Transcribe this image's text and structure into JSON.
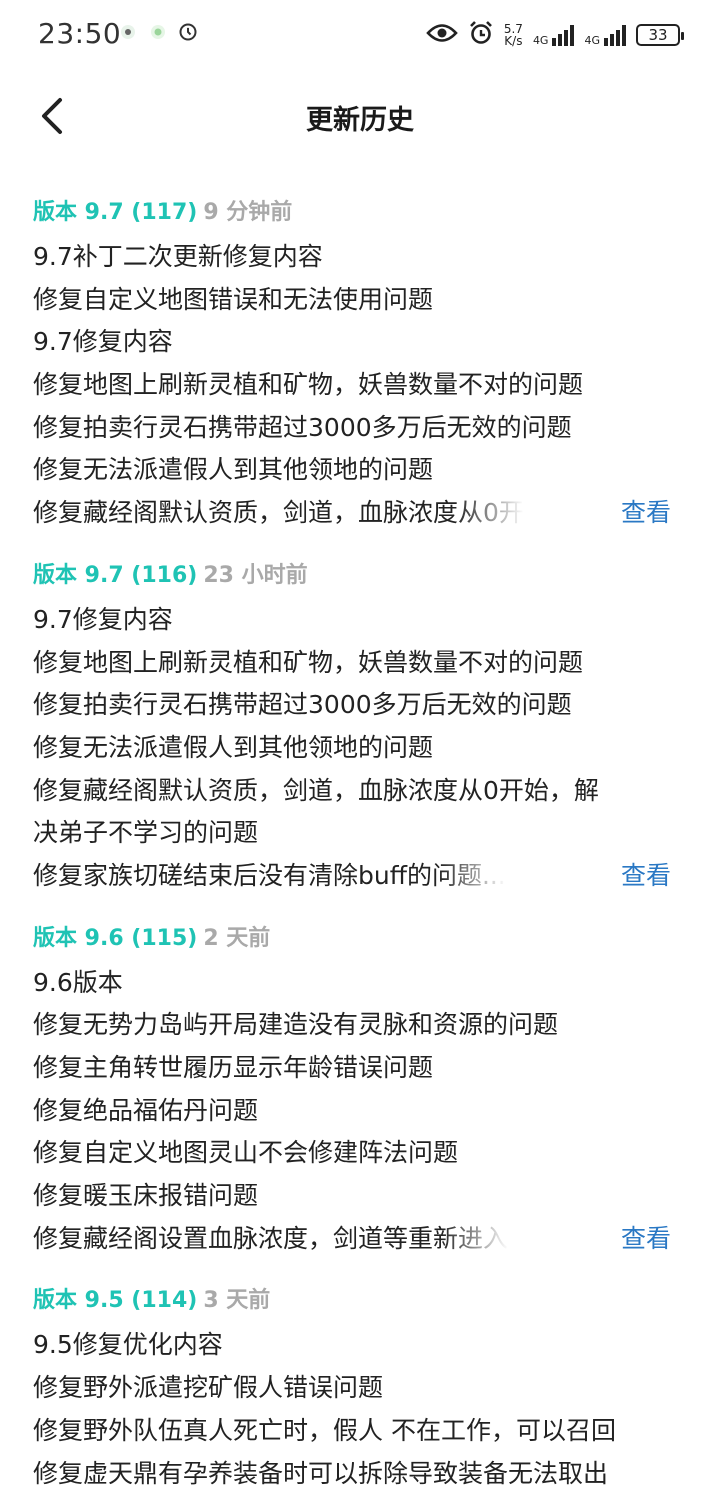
{
  "status_bar": {
    "time": "23:50",
    "speed_value": "5.7",
    "speed_unit": "K/s",
    "network1": "4G",
    "network2": "4G",
    "battery": "33",
    "icons": [
      "notification-dot-icon",
      "notification-dot-icon",
      "alarm-clock-icon",
      "eye-icon",
      "alarm-icon",
      "signal-icon",
      "battery-icon"
    ]
  },
  "header": {
    "title": "更新历史",
    "back_icon": "chevron-left-icon"
  },
  "view_label": "查看",
  "versions": [
    {
      "label": "版本 9.7 (117)",
      "time": "9 分钟前",
      "lines": [
        "9.7补丁二次更新修复内容",
        "修复自定义地图错误和无法使用问题",
        "9.7修复内容",
        "修复地图上刷新灵植和矿物，妖兽数量不对的问题",
        "修复拍卖行灵石携带超过3000多万后无效的问题",
        "修复无法派遣假人到其他领地的问题"
      ],
      "last_line": "修复藏经阁默认资质，剑道，血脉浓度从0开"
    },
    {
      "label": "版本 9.7 (116)",
      "time": "23 小时前",
      "lines": [
        "9.7修复内容",
        "修复地图上刷新灵植和矿物，妖兽数量不对的问题",
        "修复拍卖行灵石携带超过3000多万后无效的问题",
        "修复无法派遣假人到其他领地的问题",
        "修复藏经阁默认资质，剑道，血脉浓度从0开始，解",
        "决弟子不学习的问题"
      ],
      "last_line": "修复家族切磋结束后没有清除buff的问题..."
    },
    {
      "label": "版本 9.6 (115)",
      "time": "2 天前",
      "lines": [
        "9.6版本",
        "修复无势力岛屿开局建造没有灵脉和资源的问题",
        "修复主角转世履历显示年龄错误问题",
        "修复绝品福佑丹问题",
        "修复自定义地图灵山不会修建阵法问题",
        "修复暖玉床报错问题"
      ],
      "last_line": "修复藏经阁设置血脉浓度，剑道等重新进入"
    },
    {
      "label": "版本 9.5 (114)",
      "time": "3 天前",
      "lines": [
        "9.5修复优化内容",
        "修复野外派遣挖矿假人错误问题",
        "修复野外队伍真人死亡时，假人 不在工作，可以召回",
        "修复虚天鼎有孕养装备时可以拆除导致装备无法取出"
      ],
      "last_line": ""
    }
  ]
}
